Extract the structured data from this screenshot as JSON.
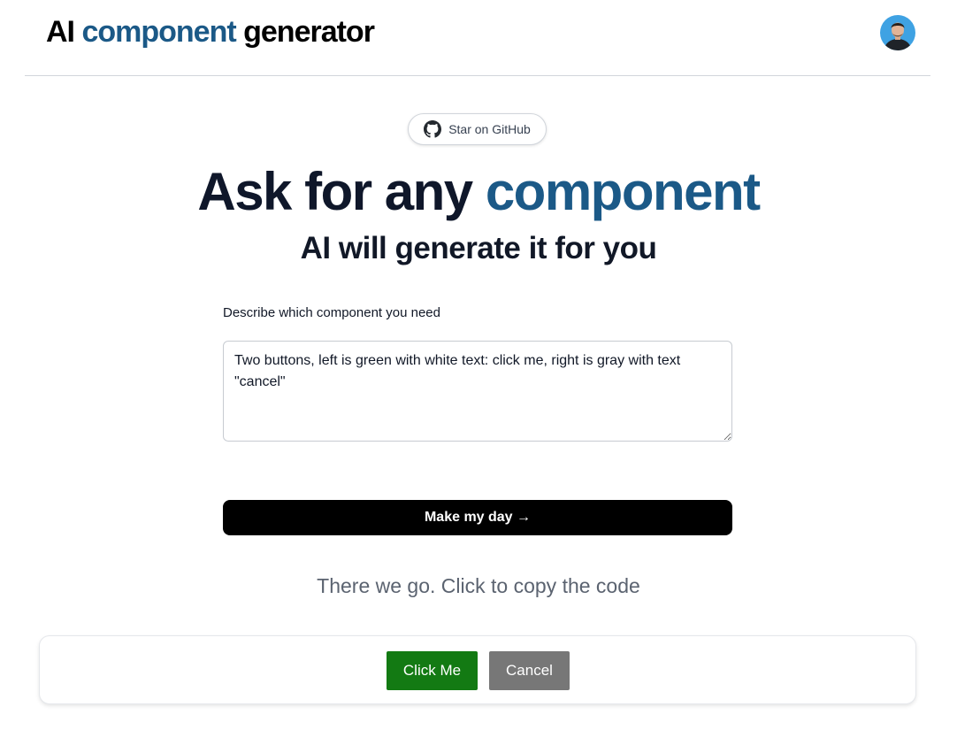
{
  "header": {
    "brand_part1": "AI ",
    "brand_accent": "component",
    "brand_part2": " generator",
    "avatar_alt": "User avatar"
  },
  "github_button": {
    "label": "Star on GitHub",
    "icon": "github-icon"
  },
  "hero": {
    "title_part1": "Ask for any ",
    "title_accent": "component",
    "subtitle": "AI will generate it for you"
  },
  "form": {
    "label": "Describe which component you need",
    "prompt_value": "Two buttons, left is green with white text: click me, right is gray with text \"cancel\"",
    "submit_label": "Make my day →"
  },
  "result": {
    "message": "There we go. Click to copy the code",
    "preview_buttons": {
      "primary": "Click Me",
      "secondary": "Cancel"
    }
  },
  "colors": {
    "accent": "#1b5987",
    "primary_button": "#137a13",
    "secondary_button": "#777777",
    "submit_bg": "#000000"
  }
}
